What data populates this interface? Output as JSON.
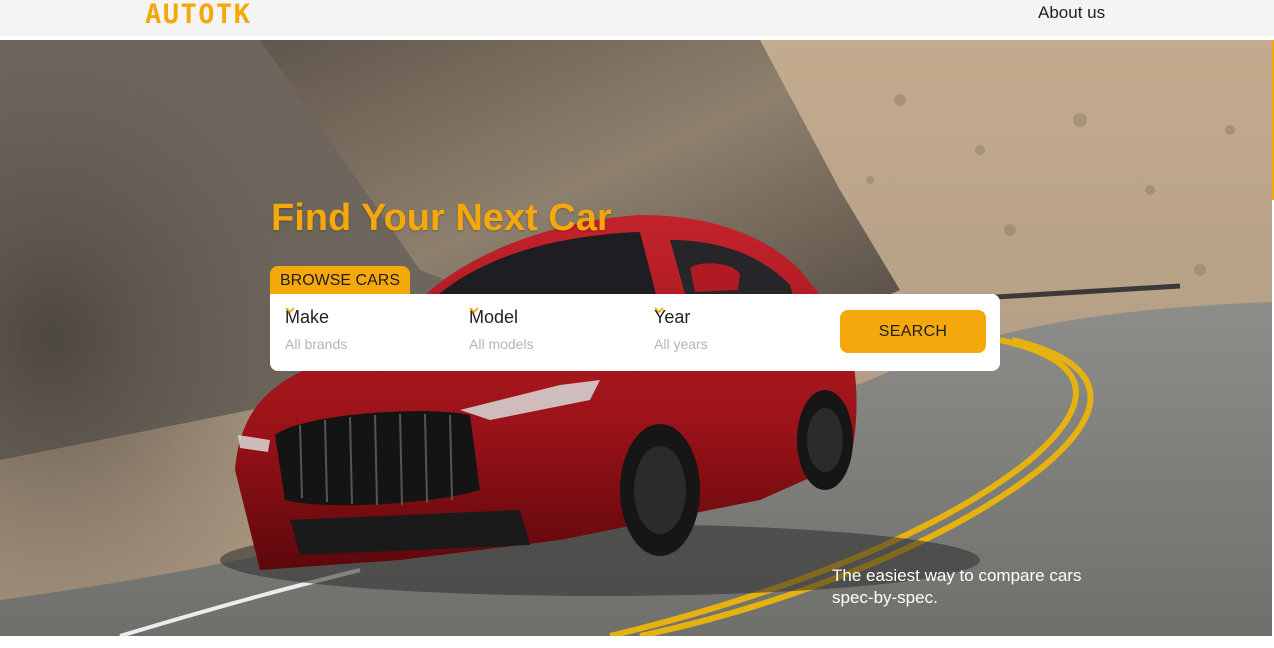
{
  "header": {
    "logo": "AUTOTK",
    "nav": {
      "about_label": "About us"
    }
  },
  "hero": {
    "title": "Find Your Next Car",
    "browse_tab_label": "BROWSE CARS",
    "filters": [
      {
        "label": "Make",
        "value": "All brands",
        "icon": "chevron-down-icon"
      },
      {
        "label": "Model",
        "value": "All models",
        "icon": "chevron-down-icon"
      },
      {
        "label": "Year",
        "value": "All years",
        "icon": "chevron-down-icon"
      }
    ],
    "search_label": "SEARCH",
    "tagline_line1": "The easiest way to compare cars",
    "tagline_line2": "spec-by-spec."
  },
  "colors": {
    "accent": "#f5a80c",
    "header_bg": "#f4f4f4",
    "panel_bg": "#ffffff",
    "placeholder_text": "#b5b5b5"
  }
}
